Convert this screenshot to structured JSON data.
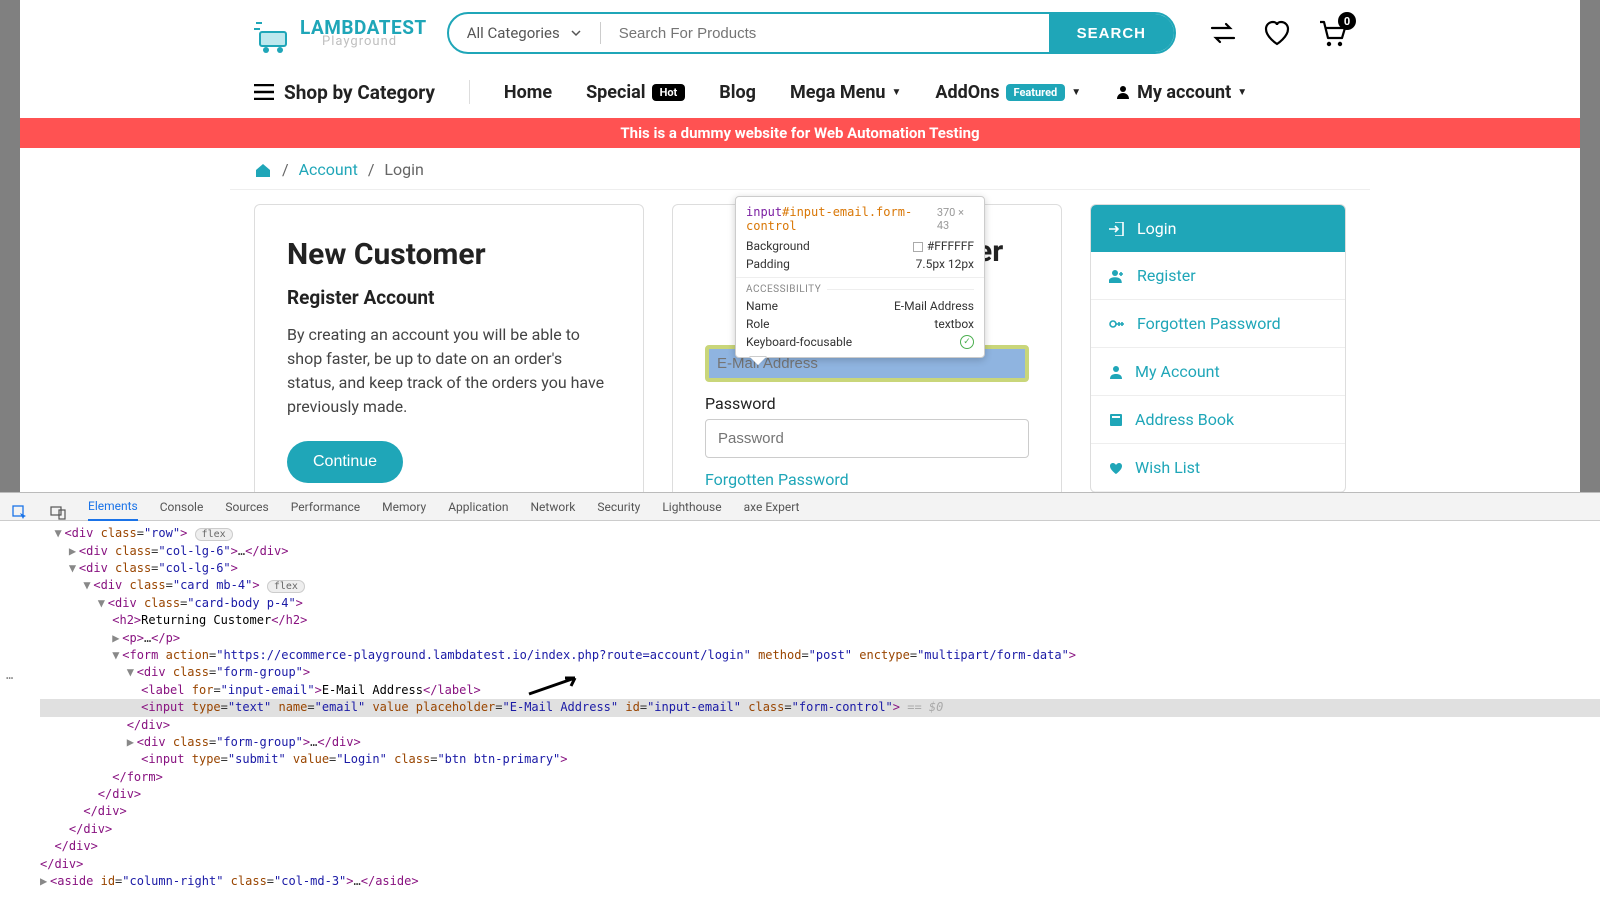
{
  "logo": {
    "brand": "LAMBDATEST",
    "sub": "Playground"
  },
  "search": {
    "categories": "All Categories",
    "placeholder": "Search For Products",
    "button": "SEARCH"
  },
  "cart_count": "0",
  "nav": {
    "shop": "Shop by Category",
    "home": "Home",
    "special": "Special",
    "hot": "Hot",
    "blog": "Blog",
    "mega": "Mega Menu",
    "addons": "AddOns",
    "featured": "Featured",
    "account": "My account"
  },
  "banner": "This is a dummy website for Web Automation Testing",
  "breadcrumb": {
    "account": "Account",
    "login": "Login"
  },
  "new_customer": {
    "title": "New Customer",
    "subtitle": "Register Account",
    "body": "By creating an account you will be able to shop faster, be up to date on an order's status, and keep track of the orders you have previously made.",
    "cta": "Continue"
  },
  "returning": {
    "title_hidden": "Returning Customer",
    "email_label": "E-Mail Address",
    "email_placeholder": "E-Mail Address",
    "password_label": "Password",
    "password_placeholder": "Password",
    "forgot": "Forgotten Password"
  },
  "sidebar": {
    "login": "Login",
    "register": "Register",
    "forgotten": "Forgotten Password",
    "myaccount": "My Account",
    "address": "Address Book",
    "wishlist": "Wish List"
  },
  "tooltip": {
    "selector_tag": "input",
    "selector_id": "#input-email",
    "selector_class": ".form-control",
    "dimensions": "370 × 43",
    "background_label": "Background",
    "background_value": "#FFFFFF",
    "padding_label": "Padding",
    "padding_value": "7.5px 12px",
    "accessibility": "ACCESSIBILITY",
    "name_label": "Name",
    "name_value": "E-Mail Address",
    "role_label": "Role",
    "role_value": "textbox",
    "kb_label": "Keyboard-focusable"
  },
  "devtools": {
    "tabs": [
      "Elements",
      "Console",
      "Sources",
      "Performance",
      "Memory",
      "Application",
      "Network",
      "Security",
      "Lighthouse",
      "axe Expert"
    ],
    "active_tab": "Elements",
    "form_action": "https://ecommerce-playground.lambdatest.io/index.php?route=account/login",
    "email_placeholder": "E-Mail Address",
    "input_id": "input-email",
    "input_class": "form-control"
  }
}
